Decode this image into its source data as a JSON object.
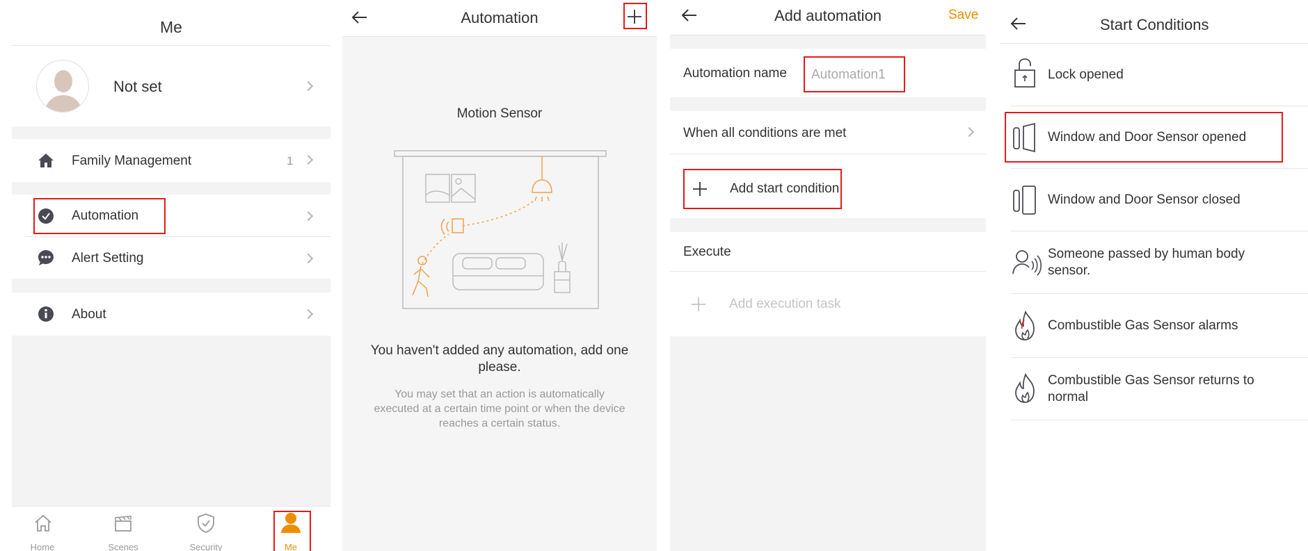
{
  "me": {
    "title": "Me",
    "profile_name": "Not set",
    "family_label": "Family Management",
    "family_count": "1",
    "automation_label": "Automation",
    "alert_label": "Alert Setting",
    "about_label": "About",
    "tabs": [
      {
        "label": "Home",
        "icon": "home-icon"
      },
      {
        "label": "Scenes",
        "icon": "clapperboard-icon"
      },
      {
        "label": "Security",
        "icon": "shield-icon"
      },
      {
        "label": "Me",
        "icon": "person-icon"
      }
    ]
  },
  "automation": {
    "title": "Automation",
    "illustration_label": "Motion Sensor",
    "empty_heading": "You haven't added any automation, add one please.",
    "empty_desc": "You may set that an action is automatically executed at a certain time point or when the device reaches a certain status."
  },
  "add": {
    "title": "Add automation",
    "save_label": "Save",
    "name_label": "Automation name",
    "name_placeholder": "Automation1",
    "condition_mode": "When all conditions are met",
    "add_condition_label": "Add start condition",
    "execute_label": "Execute",
    "add_task_label": "Add execution task"
  },
  "conditions": {
    "title": "Start Conditions",
    "items": [
      {
        "label": "Lock opened",
        "icon": "lock-open-icon"
      },
      {
        "label": "Window and Door Sensor opened",
        "icon": "door-sensor-open-icon"
      },
      {
        "label": "Window and Door Sensor closed",
        "icon": "door-sensor-closed-icon"
      },
      {
        "label": "Someone passed by human body sensor.",
        "icon": "motion-person-icon"
      },
      {
        "label": "Combustible Gas Sensor alarms",
        "icon": "flame-alarm-icon"
      },
      {
        "label": "Combustible Gas Sensor returns to normal",
        "icon": "flame-icon"
      }
    ]
  },
  "colors": {
    "accent": "#f08c00",
    "highlight": "#e21b1b",
    "divider": "#e6e6e6",
    "section_gap": "#f3f3f3"
  }
}
